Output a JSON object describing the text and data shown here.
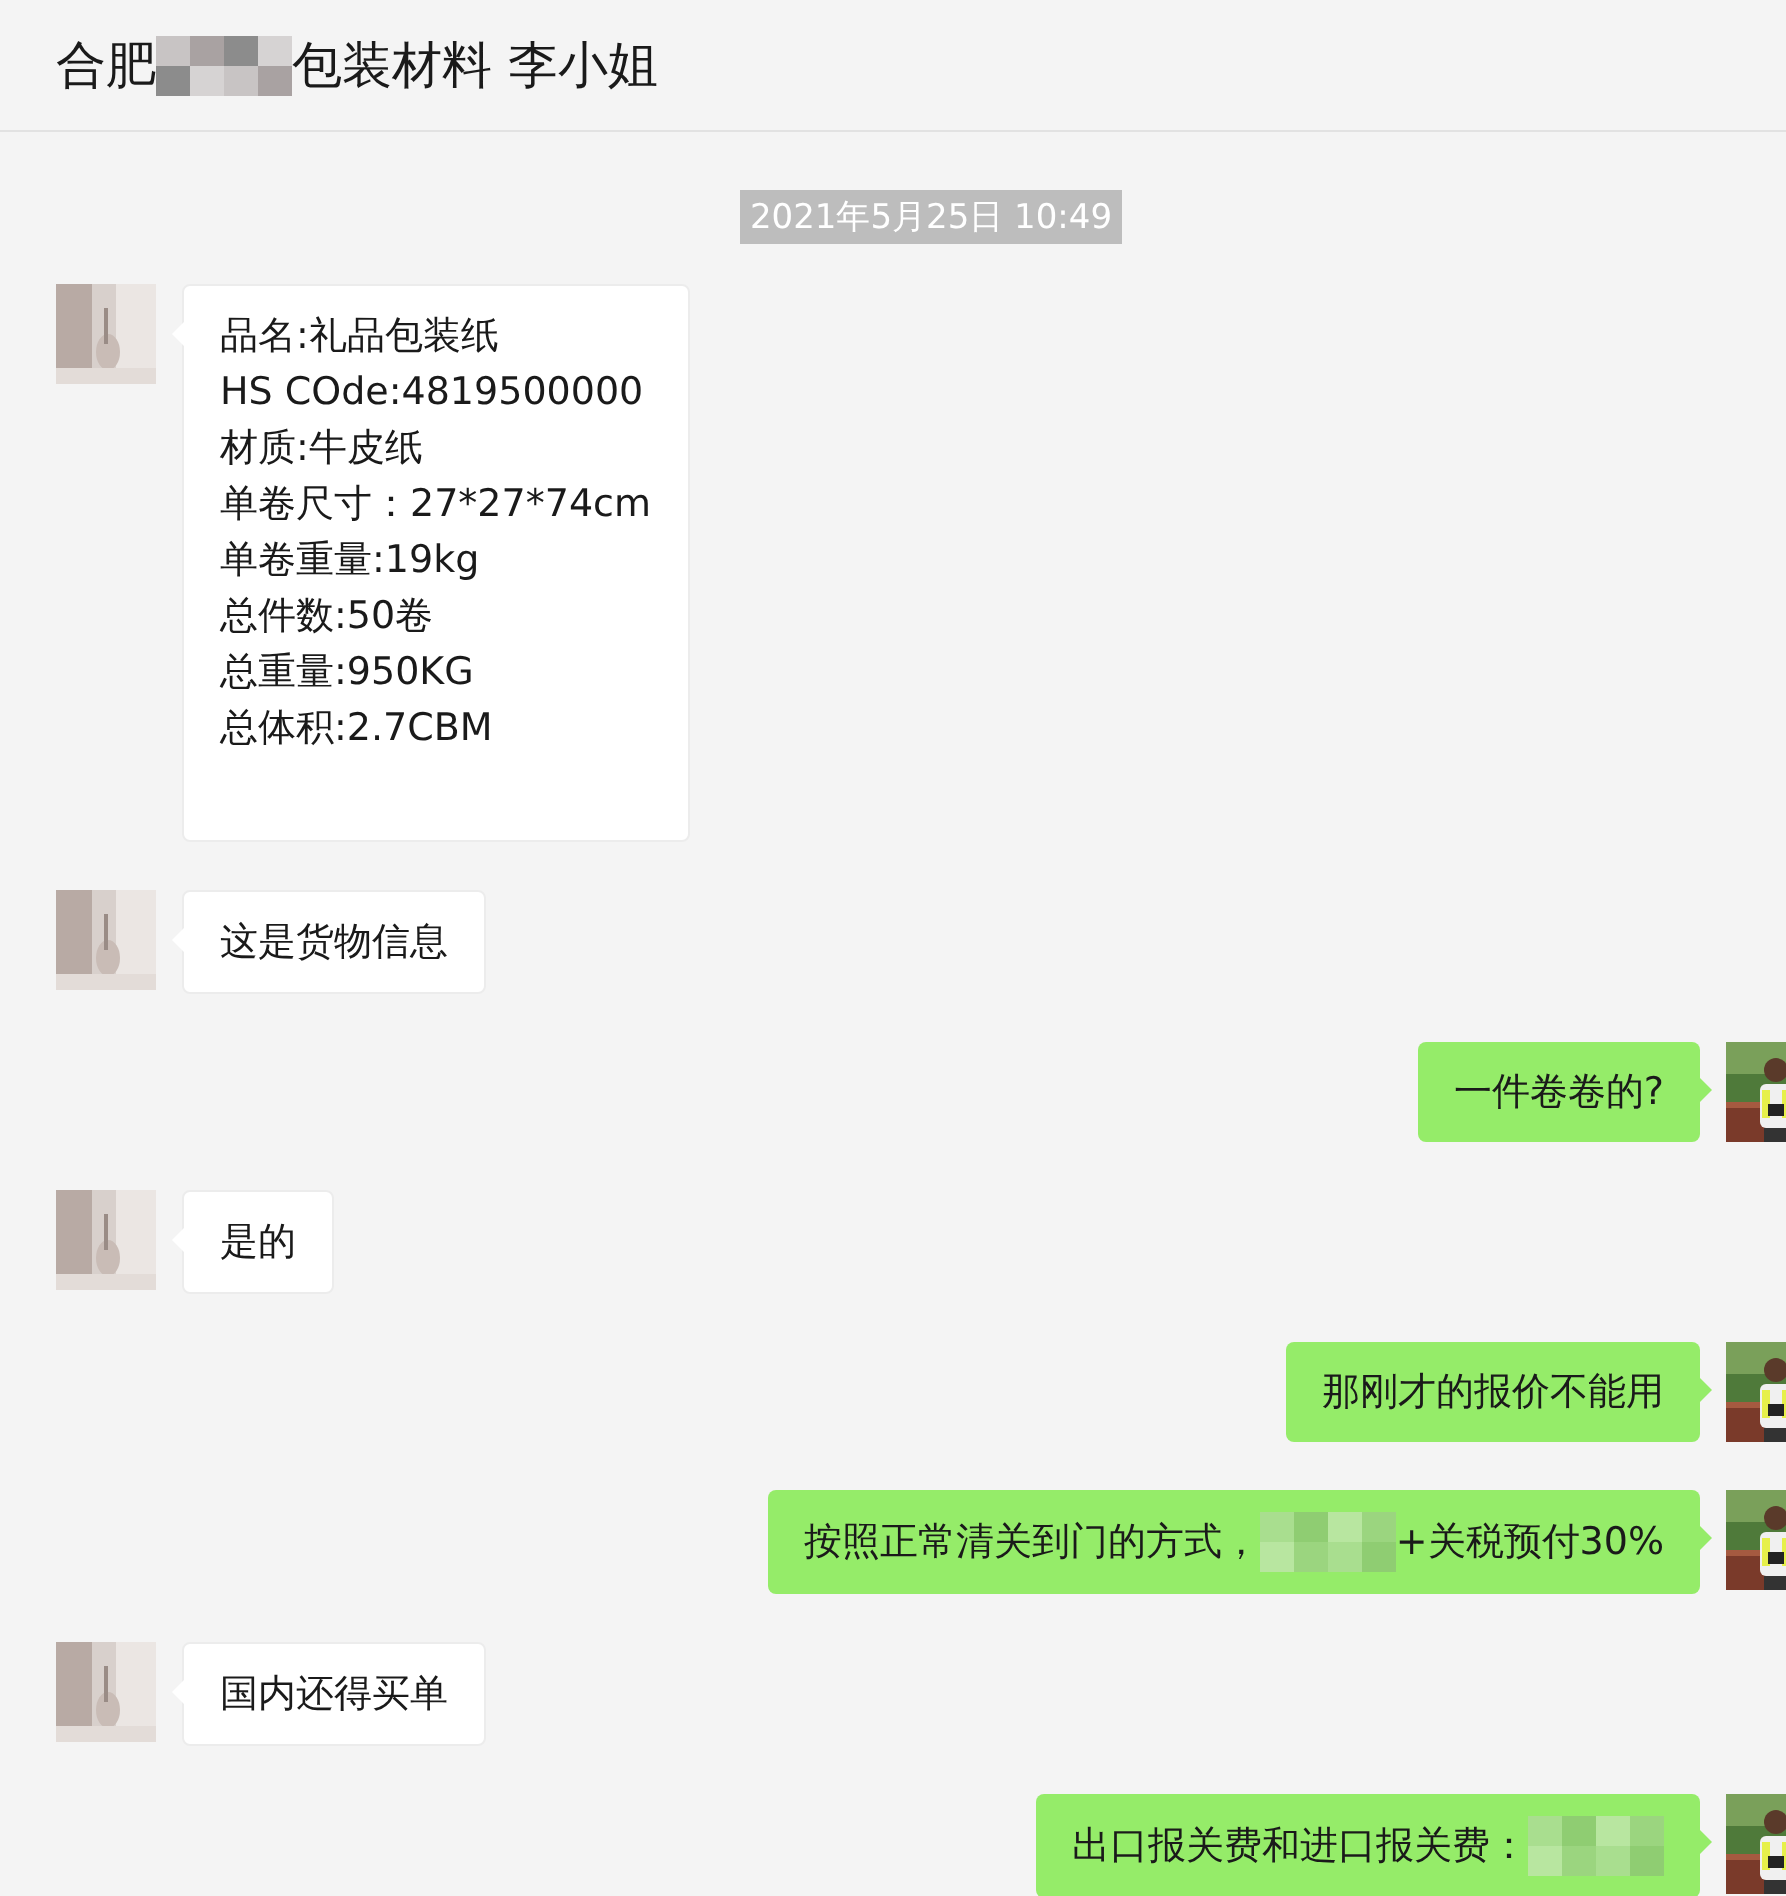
{
  "header": {
    "title": [
      {
        "kind": "text",
        "text": "合肥"
      },
      {
        "kind": "redacted"
      },
      {
        "kind": "text",
        "text": "包装材料 李小姐"
      }
    ]
  },
  "timestamp": "2021年5月25日 10:49",
  "messages": [
    {
      "outgoing": false,
      "lines": [
        [
          {
            "kind": "text",
            "text": "品名:礼品包装纸"
          }
        ],
        [
          {
            "kind": "text",
            "text": "HS COde:4819500000"
          }
        ],
        [
          {
            "kind": "text",
            "text": "材质:牛皮纸"
          }
        ],
        [
          {
            "kind": "text",
            "text": "单卷尺寸：27*27*74cm"
          }
        ],
        [
          {
            "kind": "text",
            "text": "单卷重量:19kg"
          }
        ],
        [
          {
            "kind": "text",
            "text": "总件数:50卷"
          }
        ],
        [
          {
            "kind": "text",
            "text": "总重量:950KG"
          }
        ],
        [
          {
            "kind": "text",
            "text": "总体积:2.7CBM"
          }
        ]
      ]
    },
    {
      "outgoing": false,
      "lines": [
        [
          {
            "kind": "text",
            "text": "这是货物信息"
          }
        ]
      ]
    },
    {
      "outgoing": true,
      "lines": [
        [
          {
            "kind": "text",
            "text": "一件卷卷的?"
          }
        ]
      ]
    },
    {
      "outgoing": false,
      "lines": [
        [
          {
            "kind": "text",
            "text": "是的"
          }
        ]
      ]
    },
    {
      "outgoing": true,
      "lines": [
        [
          {
            "kind": "text",
            "text": "那刚才的报价不能用"
          }
        ]
      ]
    },
    {
      "outgoing": true,
      "lines": [
        [
          {
            "kind": "text",
            "text": "按照正常清关到门的方式，"
          },
          {
            "kind": "redacted"
          },
          {
            "kind": "text",
            "text": "+关税预付30%"
          }
        ]
      ]
    },
    {
      "outgoing": false,
      "lines": [
        [
          {
            "kind": "text",
            "text": "国内还得买单"
          }
        ]
      ]
    },
    {
      "outgoing": true,
      "lines": [
        [
          {
            "kind": "text",
            "text": "出口报关费和进口报关费："
          },
          {
            "kind": "redacted"
          }
        ]
      ]
    }
  ]
}
